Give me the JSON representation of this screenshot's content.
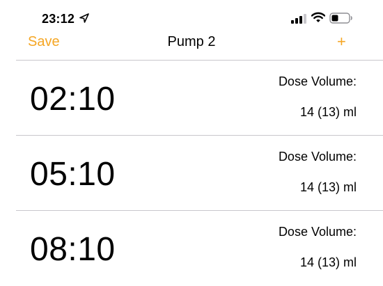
{
  "status_bar": {
    "time": "23:12",
    "icons": [
      "location-arrow-icon",
      "cellular-signal-icon",
      "wifi-icon",
      "battery-icon"
    ]
  },
  "nav": {
    "save_label": "Save",
    "title": "Pump 2",
    "add_label": "+",
    "accent_color": "#f5a623"
  },
  "doses": [
    {
      "time": "02:10",
      "label": "Dose Volume:",
      "value": "14 (13) ml"
    },
    {
      "time": "05:10",
      "label": "Dose Volume:",
      "value": "14 (13) ml"
    },
    {
      "time": "08:10",
      "label": "Dose Volume:",
      "value": "14 (13) ml"
    }
  ]
}
